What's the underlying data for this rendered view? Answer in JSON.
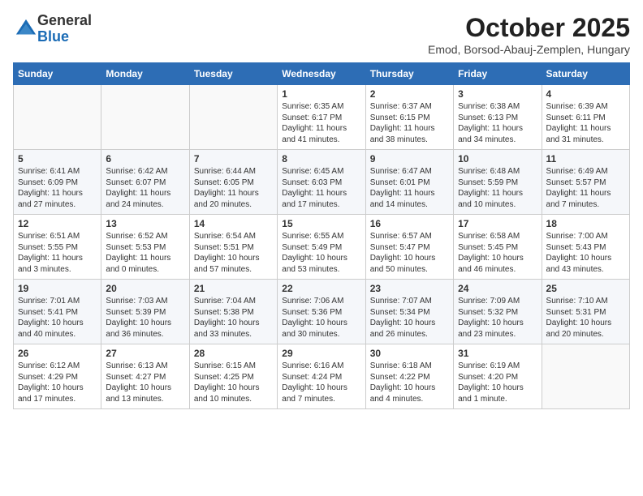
{
  "logo": {
    "general": "General",
    "blue": "Blue"
  },
  "header": {
    "title": "October 2025",
    "subtitle": "Emod, Borsod-Abauj-Zemplen, Hungary"
  },
  "weekdays": [
    "Sunday",
    "Monday",
    "Tuesday",
    "Wednesday",
    "Thursday",
    "Friday",
    "Saturday"
  ],
  "weeks": [
    [
      {
        "day": "",
        "info": ""
      },
      {
        "day": "",
        "info": ""
      },
      {
        "day": "",
        "info": ""
      },
      {
        "day": "1",
        "info": "Sunrise: 6:35 AM\nSunset: 6:17 PM\nDaylight: 11 hours\nand 41 minutes."
      },
      {
        "day": "2",
        "info": "Sunrise: 6:37 AM\nSunset: 6:15 PM\nDaylight: 11 hours\nand 38 minutes."
      },
      {
        "day": "3",
        "info": "Sunrise: 6:38 AM\nSunset: 6:13 PM\nDaylight: 11 hours\nand 34 minutes."
      },
      {
        "day": "4",
        "info": "Sunrise: 6:39 AM\nSunset: 6:11 PM\nDaylight: 11 hours\nand 31 minutes."
      }
    ],
    [
      {
        "day": "5",
        "info": "Sunrise: 6:41 AM\nSunset: 6:09 PM\nDaylight: 11 hours\nand 27 minutes."
      },
      {
        "day": "6",
        "info": "Sunrise: 6:42 AM\nSunset: 6:07 PM\nDaylight: 11 hours\nand 24 minutes."
      },
      {
        "day": "7",
        "info": "Sunrise: 6:44 AM\nSunset: 6:05 PM\nDaylight: 11 hours\nand 20 minutes."
      },
      {
        "day": "8",
        "info": "Sunrise: 6:45 AM\nSunset: 6:03 PM\nDaylight: 11 hours\nand 17 minutes."
      },
      {
        "day": "9",
        "info": "Sunrise: 6:47 AM\nSunset: 6:01 PM\nDaylight: 11 hours\nand 14 minutes."
      },
      {
        "day": "10",
        "info": "Sunrise: 6:48 AM\nSunset: 5:59 PM\nDaylight: 11 hours\nand 10 minutes."
      },
      {
        "day": "11",
        "info": "Sunrise: 6:49 AM\nSunset: 5:57 PM\nDaylight: 11 hours\nand 7 minutes."
      }
    ],
    [
      {
        "day": "12",
        "info": "Sunrise: 6:51 AM\nSunset: 5:55 PM\nDaylight: 11 hours\nand 3 minutes."
      },
      {
        "day": "13",
        "info": "Sunrise: 6:52 AM\nSunset: 5:53 PM\nDaylight: 11 hours\nand 0 minutes."
      },
      {
        "day": "14",
        "info": "Sunrise: 6:54 AM\nSunset: 5:51 PM\nDaylight: 10 hours\nand 57 minutes."
      },
      {
        "day": "15",
        "info": "Sunrise: 6:55 AM\nSunset: 5:49 PM\nDaylight: 10 hours\nand 53 minutes."
      },
      {
        "day": "16",
        "info": "Sunrise: 6:57 AM\nSunset: 5:47 PM\nDaylight: 10 hours\nand 50 minutes."
      },
      {
        "day": "17",
        "info": "Sunrise: 6:58 AM\nSunset: 5:45 PM\nDaylight: 10 hours\nand 46 minutes."
      },
      {
        "day": "18",
        "info": "Sunrise: 7:00 AM\nSunset: 5:43 PM\nDaylight: 10 hours\nand 43 minutes."
      }
    ],
    [
      {
        "day": "19",
        "info": "Sunrise: 7:01 AM\nSunset: 5:41 PM\nDaylight: 10 hours\nand 40 minutes."
      },
      {
        "day": "20",
        "info": "Sunrise: 7:03 AM\nSunset: 5:39 PM\nDaylight: 10 hours\nand 36 minutes."
      },
      {
        "day": "21",
        "info": "Sunrise: 7:04 AM\nSunset: 5:38 PM\nDaylight: 10 hours\nand 33 minutes."
      },
      {
        "day": "22",
        "info": "Sunrise: 7:06 AM\nSunset: 5:36 PM\nDaylight: 10 hours\nand 30 minutes."
      },
      {
        "day": "23",
        "info": "Sunrise: 7:07 AM\nSunset: 5:34 PM\nDaylight: 10 hours\nand 26 minutes."
      },
      {
        "day": "24",
        "info": "Sunrise: 7:09 AM\nSunset: 5:32 PM\nDaylight: 10 hours\nand 23 minutes."
      },
      {
        "day": "25",
        "info": "Sunrise: 7:10 AM\nSunset: 5:31 PM\nDaylight: 10 hours\nand 20 minutes."
      }
    ],
    [
      {
        "day": "26",
        "info": "Sunrise: 6:12 AM\nSunset: 4:29 PM\nDaylight: 10 hours\nand 17 minutes."
      },
      {
        "day": "27",
        "info": "Sunrise: 6:13 AM\nSunset: 4:27 PM\nDaylight: 10 hours\nand 13 minutes."
      },
      {
        "day": "28",
        "info": "Sunrise: 6:15 AM\nSunset: 4:25 PM\nDaylight: 10 hours\nand 10 minutes."
      },
      {
        "day": "29",
        "info": "Sunrise: 6:16 AM\nSunset: 4:24 PM\nDaylight: 10 hours\nand 7 minutes."
      },
      {
        "day": "30",
        "info": "Sunrise: 6:18 AM\nSunset: 4:22 PM\nDaylight: 10 hours\nand 4 minutes."
      },
      {
        "day": "31",
        "info": "Sunrise: 6:19 AM\nSunset: 4:20 PM\nDaylight: 10 hours\nand 1 minute."
      },
      {
        "day": "",
        "info": ""
      }
    ]
  ]
}
